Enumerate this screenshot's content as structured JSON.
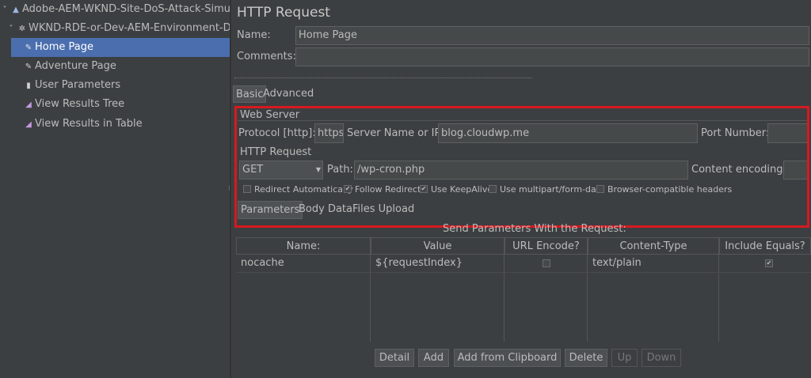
{
  "tree": {
    "items": [
      {
        "label": "Adobe-AEM-WKND-Site-DoS-Attack-Simula",
        "icon": "test-plan-icon"
      },
      {
        "label": "WKND-RDE-or-Dev-AEM-Environment-DC",
        "icon": "thread-group-icon"
      },
      {
        "label": "Home Page",
        "icon": "sampler-pencil-icon"
      },
      {
        "label": "Adventure Page",
        "icon": "sampler-pencil-icon"
      },
      {
        "label": "User Parameters",
        "icon": "preprocessor-icon"
      },
      {
        "label": "View Results Tree",
        "icon": "listener-icon"
      },
      {
        "label": "View Results in Table",
        "icon": "listener-icon"
      }
    ]
  },
  "panel": {
    "title": "HTTP Request",
    "name_label": "Name:",
    "name_value": "Home Page",
    "comments_label": "Comments:",
    "comments_value": "",
    "tabs": [
      "Basic",
      "Advanced"
    ],
    "web_server": {
      "legend": "Web Server",
      "protocol_label": "Protocol [http]:",
      "protocol_value": "https",
      "server_label": "Server Name or IP:",
      "server_value": "blog.cloudwp.me",
      "port_label": "Port Number:",
      "port_value": ""
    },
    "http_request": {
      "legend": "HTTP Request",
      "method_value": "GET",
      "path_label": "Path:",
      "path_value": "/wp-cron.php",
      "encoding_label": "Content encoding:",
      "encoding_value": ""
    },
    "checkboxes": [
      {
        "label": "Redirect Automatically",
        "checked": false
      },
      {
        "label": "Follow Redirects",
        "checked": true
      },
      {
        "label": "Use KeepAlive",
        "checked": true
      },
      {
        "label": "Use multipart/form-data",
        "checked": false
      },
      {
        "label": "Browser-compatible headers",
        "checked": false
      }
    ],
    "subtabs": [
      "Parameters",
      "Body Data",
      "Files Upload"
    ],
    "params_caption": "Send Parameters With the Request:",
    "table": {
      "headers": [
        "Name:",
        "Value",
        "URL Encode?",
        "Content-Type",
        "Include Equals?"
      ],
      "rows": [
        {
          "name": "nocache",
          "value": "${requestIndex}",
          "url_encode": false,
          "content_type": "text/plain",
          "include_equals": true
        }
      ]
    },
    "buttons": [
      "Detail",
      "Add",
      "Add from Clipboard",
      "Delete",
      "Up",
      "Down"
    ],
    "highlight_color": "#d71920",
    "selection_color": "#4b6eaf"
  }
}
